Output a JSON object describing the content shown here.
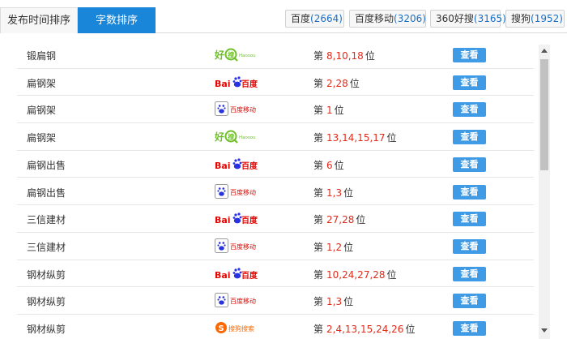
{
  "sort_tabs": [
    "发布时间排序",
    "字数排序"
  ],
  "engine_tabs": [
    {
      "label": "百度",
      "count": "(2664)"
    },
    {
      "label": "百度移动",
      "count": "(3206)"
    },
    {
      "label": "360好搜",
      "count": "(3165)"
    },
    {
      "label": "搜狗",
      "count": "(1952)"
    }
  ],
  "rank_prefix": "第",
  "rank_suffix": "位",
  "view_label": "查看",
  "engine_logos": {
    "haosou": {
      "text": "好搜",
      "sub": "Haosou",
      "color": "#6fbf2a"
    },
    "baidu": {
      "text1": "Bai",
      "text2": "百度",
      "color1": "#e10602",
      "color2": "#2932e1"
    },
    "baidu_mobile": {
      "text": "百度移动",
      "color": "#e10602",
      "icon_color": "#2932e1"
    },
    "sogou": {
      "text": "搜狗搜索",
      "color": "#fd6802"
    }
  },
  "rows": [
    {
      "keyword": "锻扁钢",
      "engine": "haosou",
      "positions": "8,10,18"
    },
    {
      "keyword": "扁钢架",
      "engine": "baidu",
      "positions": "2,28"
    },
    {
      "keyword": "扁钢架",
      "engine": "baidu_mobile",
      "positions": "1"
    },
    {
      "keyword": "扁钢架",
      "engine": "haosou",
      "positions": "13,14,15,17"
    },
    {
      "keyword": "扁钢出售",
      "engine": "baidu",
      "positions": "6"
    },
    {
      "keyword": "扁钢出售",
      "engine": "baidu_mobile",
      "positions": "1,3"
    },
    {
      "keyword": "三信建材",
      "engine": "baidu",
      "positions": "27,28"
    },
    {
      "keyword": "三信建材",
      "engine": "baidu_mobile",
      "positions": "1,2"
    },
    {
      "keyword": "钢材纵剪",
      "engine": "baidu",
      "positions": "10,24,27,28"
    },
    {
      "keyword": "钢材纵剪",
      "engine": "baidu_mobile",
      "positions": "1,3"
    },
    {
      "keyword": "钢材纵剪",
      "engine": "sogou",
      "positions": "2,4,13,15,24,26"
    }
  ]
}
